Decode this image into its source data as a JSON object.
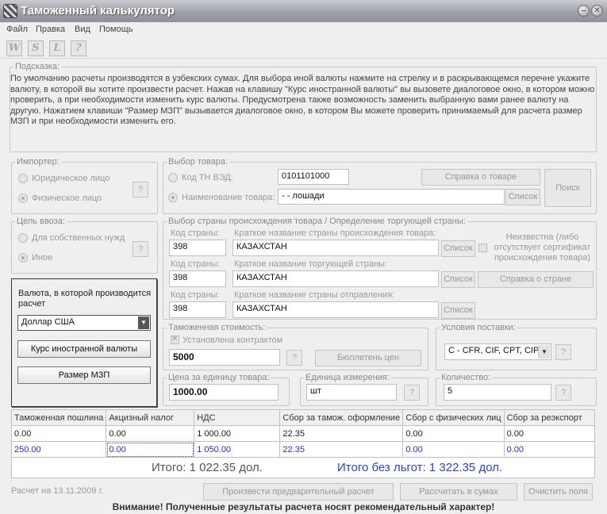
{
  "window": {
    "title": "Таможенный калькулятор",
    "minimize": "–",
    "close": "✕"
  },
  "menu": {
    "file": "Файл",
    "edit": "Правка",
    "view": "Вид",
    "help": "Помощь"
  },
  "toolbar": {
    "w": "W",
    "s": "S",
    "l": "L",
    "q": "?"
  },
  "hint": {
    "legend": "Подсказка:",
    "text": "По умолчанию расчеты производятся в узбекских сумах. Для выбора иной валюты нажмите на стрелку и в раскрывающемся перечне укажите валюту, в которой вы хотите произвести расчет. Нажав на клавишу \"Курс иностранной валюты\" вы вызовете диалоговое окно, в котором можно проверить, а при необходимости изменить курс валюты. Предусмотрена также возможность заменить выбранную вами ранее валюту на другую. Нажатием клавиши \"Размер МЗП\" вызывается диалоговое окно, в котором Вы можете проверить принимаемый для расчета размер МЗП и при необходимости изменить его."
  },
  "importer": {
    "legend": "Импортер:",
    "legal": "Юридическое лицо",
    "physical": "Физическое лицо",
    "help": "?"
  },
  "purpose": {
    "legend": "Цель ввоза:",
    "own": "Для собственных нужд",
    "other": "Иное",
    "help": "?"
  },
  "goods": {
    "legend": "Выбор товара:",
    "code_label": "Код ТН ВЭД:",
    "code_value": "0101101000",
    "name_label": "Наименование товара:",
    "name_value": "- - лошади",
    "info_button": "Справка о товаре",
    "list_button": "Список",
    "search_button": "Поиск"
  },
  "country": {
    "legend": "Выбор страны происхождения товара / Определение торгующей страны:",
    "code_label": "Код страны:",
    "origin_label": "Краткое название страны происхождения товара:",
    "trade_label": "Краткое название торгующей страны:",
    "dispatch_label": "Краткое название страны отправления:",
    "origin_code": "398",
    "origin_name": "КАЗАХСТАН",
    "trade_code": "398",
    "trade_name": "КАЗАХСТАН",
    "dispatch_code": "398",
    "dispatch_name": "КАЗАХСТАН",
    "list_button": "Список",
    "unknown_label": "Неизвестна (либо отсутствует сертификат происхождения товара)",
    "info_button": "Справка о стране"
  },
  "currency": {
    "label": "Валюта, в которой производится расчет",
    "selected": "Доллар США",
    "rate_button": "Курс иностранной валюты",
    "mzp_button": "Размер МЗП"
  },
  "customs_value": {
    "legend": "Таможенная стоимость:",
    "contract_label": "Установлена контрактом",
    "value": "5000",
    "help": "?",
    "bulletin_button": "Бюллетень цен"
  },
  "delivery": {
    "legend": "Условия поставки:",
    "selected": "C - CFR, CIF, CPT, CIP",
    "help": "?"
  },
  "unit_price": {
    "legend": "Цена за единицу товара:",
    "value": "1000.00"
  },
  "unit": {
    "legend": "Единица измерения:",
    "value": "шт",
    "help": "?"
  },
  "quantity": {
    "legend": "Количество:",
    "value": "5",
    "help": "?"
  },
  "results": {
    "headers": [
      "Таможенная пошлина",
      "Акцизный налог",
      "НДС",
      "Сбор за тамож. оформление",
      "Сбор с физических лиц",
      "Сбор за реэкспорт"
    ],
    "row1": [
      "0.00",
      "0.00",
      "1 000.00",
      "22.35",
      "0.00",
      "0.00"
    ],
    "row2": [
      "250.00",
      "0.00",
      "1 050.00",
      "22.35",
      "0.00",
      "0.00"
    ],
    "total": "Итого: 1 022.35 дол.",
    "total_no_benefits": "Итого без льгот: 1 322.35 дол."
  },
  "footer": {
    "date": "Расчет на 13.11.2009 г.",
    "prelim_button": "Произвести предварительный расчет",
    "sums_button": "Рассчитать в сумах",
    "clear_button": "Очистить поля",
    "warning": "Внимание! Полученные результаты расчета носят рекомендательный характер!"
  }
}
